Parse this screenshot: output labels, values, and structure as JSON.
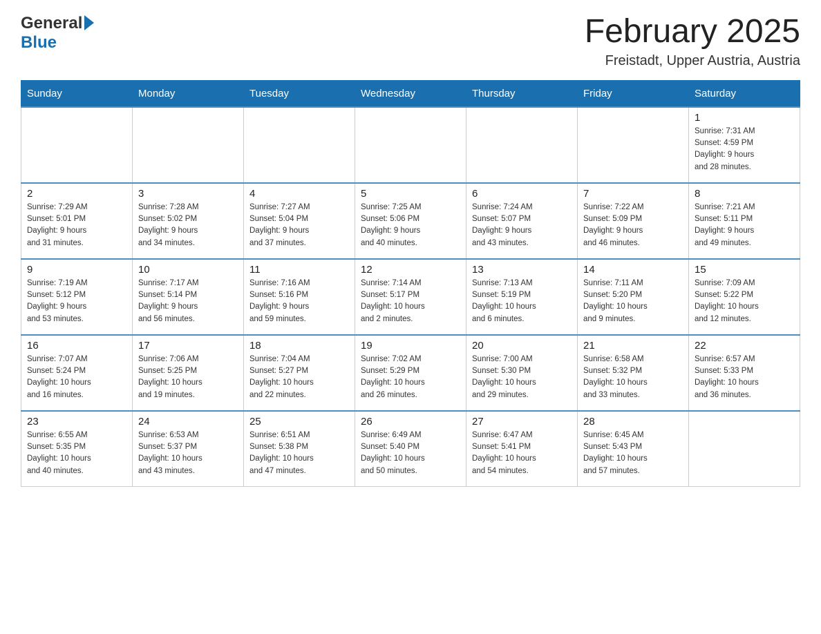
{
  "header": {
    "logo_general": "General",
    "logo_blue": "Blue",
    "month_title": "February 2025",
    "location": "Freistadt, Upper Austria, Austria"
  },
  "days_of_week": [
    "Sunday",
    "Monday",
    "Tuesday",
    "Wednesday",
    "Thursday",
    "Friday",
    "Saturday"
  ],
  "weeks": [
    {
      "days": [
        {
          "num": "",
          "info": "",
          "empty": true
        },
        {
          "num": "",
          "info": "",
          "empty": true
        },
        {
          "num": "",
          "info": "",
          "empty": true
        },
        {
          "num": "",
          "info": "",
          "empty": true
        },
        {
          "num": "",
          "info": "",
          "empty": true
        },
        {
          "num": "",
          "info": "",
          "empty": true
        },
        {
          "num": "1",
          "info": "Sunrise: 7:31 AM\nSunset: 4:59 PM\nDaylight: 9 hours\nand 28 minutes.",
          "empty": false
        }
      ]
    },
    {
      "days": [
        {
          "num": "2",
          "info": "Sunrise: 7:29 AM\nSunset: 5:01 PM\nDaylight: 9 hours\nand 31 minutes.",
          "empty": false
        },
        {
          "num": "3",
          "info": "Sunrise: 7:28 AM\nSunset: 5:02 PM\nDaylight: 9 hours\nand 34 minutes.",
          "empty": false
        },
        {
          "num": "4",
          "info": "Sunrise: 7:27 AM\nSunset: 5:04 PM\nDaylight: 9 hours\nand 37 minutes.",
          "empty": false
        },
        {
          "num": "5",
          "info": "Sunrise: 7:25 AM\nSunset: 5:06 PM\nDaylight: 9 hours\nand 40 minutes.",
          "empty": false
        },
        {
          "num": "6",
          "info": "Sunrise: 7:24 AM\nSunset: 5:07 PM\nDaylight: 9 hours\nand 43 minutes.",
          "empty": false
        },
        {
          "num": "7",
          "info": "Sunrise: 7:22 AM\nSunset: 5:09 PM\nDaylight: 9 hours\nand 46 minutes.",
          "empty": false
        },
        {
          "num": "8",
          "info": "Sunrise: 7:21 AM\nSunset: 5:11 PM\nDaylight: 9 hours\nand 49 minutes.",
          "empty": false
        }
      ]
    },
    {
      "days": [
        {
          "num": "9",
          "info": "Sunrise: 7:19 AM\nSunset: 5:12 PM\nDaylight: 9 hours\nand 53 minutes.",
          "empty": false
        },
        {
          "num": "10",
          "info": "Sunrise: 7:17 AM\nSunset: 5:14 PM\nDaylight: 9 hours\nand 56 minutes.",
          "empty": false
        },
        {
          "num": "11",
          "info": "Sunrise: 7:16 AM\nSunset: 5:16 PM\nDaylight: 9 hours\nand 59 minutes.",
          "empty": false
        },
        {
          "num": "12",
          "info": "Sunrise: 7:14 AM\nSunset: 5:17 PM\nDaylight: 10 hours\nand 2 minutes.",
          "empty": false
        },
        {
          "num": "13",
          "info": "Sunrise: 7:13 AM\nSunset: 5:19 PM\nDaylight: 10 hours\nand 6 minutes.",
          "empty": false
        },
        {
          "num": "14",
          "info": "Sunrise: 7:11 AM\nSunset: 5:20 PM\nDaylight: 10 hours\nand 9 minutes.",
          "empty": false
        },
        {
          "num": "15",
          "info": "Sunrise: 7:09 AM\nSunset: 5:22 PM\nDaylight: 10 hours\nand 12 minutes.",
          "empty": false
        }
      ]
    },
    {
      "days": [
        {
          "num": "16",
          "info": "Sunrise: 7:07 AM\nSunset: 5:24 PM\nDaylight: 10 hours\nand 16 minutes.",
          "empty": false
        },
        {
          "num": "17",
          "info": "Sunrise: 7:06 AM\nSunset: 5:25 PM\nDaylight: 10 hours\nand 19 minutes.",
          "empty": false
        },
        {
          "num": "18",
          "info": "Sunrise: 7:04 AM\nSunset: 5:27 PM\nDaylight: 10 hours\nand 22 minutes.",
          "empty": false
        },
        {
          "num": "19",
          "info": "Sunrise: 7:02 AM\nSunset: 5:29 PM\nDaylight: 10 hours\nand 26 minutes.",
          "empty": false
        },
        {
          "num": "20",
          "info": "Sunrise: 7:00 AM\nSunset: 5:30 PM\nDaylight: 10 hours\nand 29 minutes.",
          "empty": false
        },
        {
          "num": "21",
          "info": "Sunrise: 6:58 AM\nSunset: 5:32 PM\nDaylight: 10 hours\nand 33 minutes.",
          "empty": false
        },
        {
          "num": "22",
          "info": "Sunrise: 6:57 AM\nSunset: 5:33 PM\nDaylight: 10 hours\nand 36 minutes.",
          "empty": false
        }
      ]
    },
    {
      "days": [
        {
          "num": "23",
          "info": "Sunrise: 6:55 AM\nSunset: 5:35 PM\nDaylight: 10 hours\nand 40 minutes.",
          "empty": false
        },
        {
          "num": "24",
          "info": "Sunrise: 6:53 AM\nSunset: 5:37 PM\nDaylight: 10 hours\nand 43 minutes.",
          "empty": false
        },
        {
          "num": "25",
          "info": "Sunrise: 6:51 AM\nSunset: 5:38 PM\nDaylight: 10 hours\nand 47 minutes.",
          "empty": false
        },
        {
          "num": "26",
          "info": "Sunrise: 6:49 AM\nSunset: 5:40 PM\nDaylight: 10 hours\nand 50 minutes.",
          "empty": false
        },
        {
          "num": "27",
          "info": "Sunrise: 6:47 AM\nSunset: 5:41 PM\nDaylight: 10 hours\nand 54 minutes.",
          "empty": false
        },
        {
          "num": "28",
          "info": "Sunrise: 6:45 AM\nSunset: 5:43 PM\nDaylight: 10 hours\nand 57 minutes.",
          "empty": false
        },
        {
          "num": "",
          "info": "",
          "empty": true
        }
      ]
    }
  ]
}
